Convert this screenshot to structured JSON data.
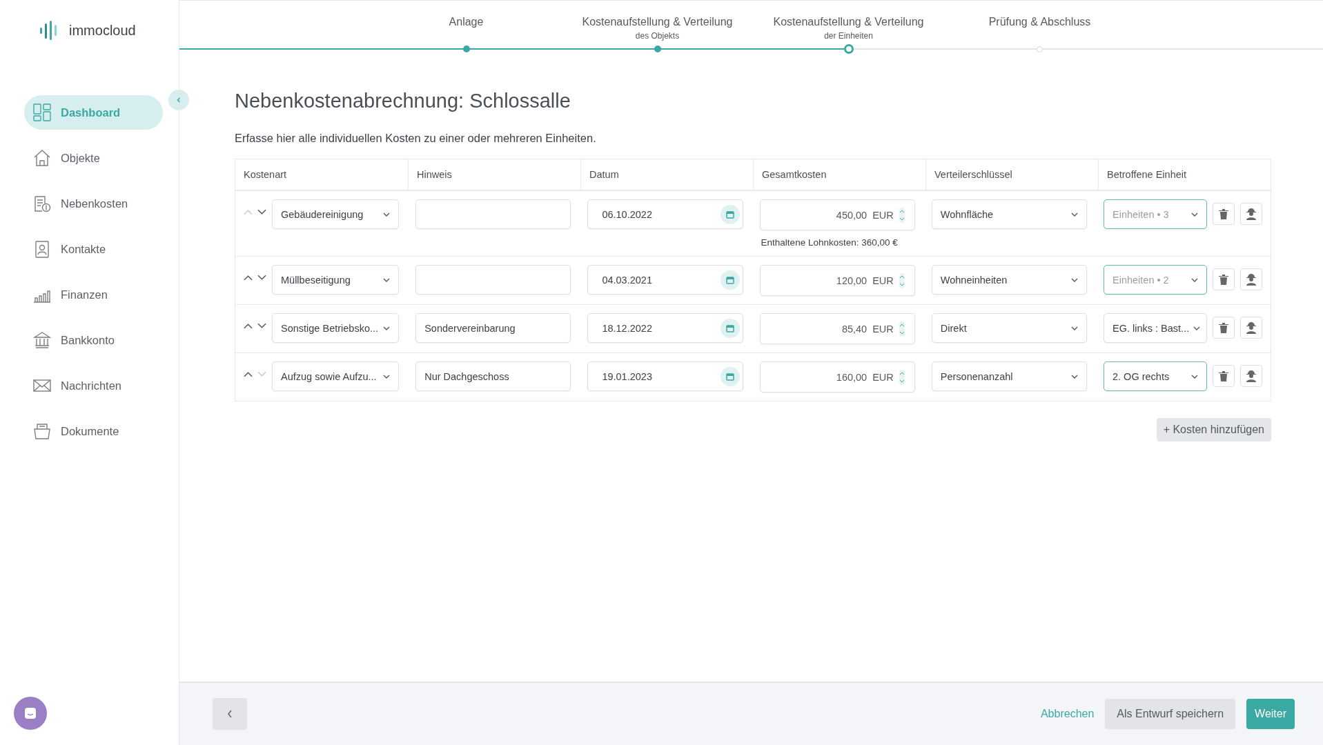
{
  "brand": {
    "name": "immocloud"
  },
  "sidebar": {
    "items": [
      {
        "label": "Dashboard",
        "selected": true
      },
      {
        "label": "Objekte",
        "selected": false
      },
      {
        "label": "Nebenkosten",
        "selected": false
      },
      {
        "label": "Kontakte",
        "selected": false
      },
      {
        "label": "Finanzen",
        "selected": false
      },
      {
        "label": "Bankkonto",
        "selected": false
      },
      {
        "label": "Nachrichten",
        "selected": false
      },
      {
        "label": "Dokumente",
        "selected": false
      }
    ]
  },
  "stepper": {
    "steps": [
      {
        "title": "Anlage",
        "completed": true,
        "selected": false
      },
      {
        "title": "Kostenaufstellung & Verteilung",
        "subtitle": "des Objekts",
        "completed": true,
        "selected": false
      },
      {
        "title": "Kostenaufstellung & Verteilung",
        "subtitle": "der Einheiten",
        "completed": false,
        "selected": true
      },
      {
        "title": "Prüfung & Abschluss",
        "completed": false,
        "selected": false
      }
    ]
  },
  "page": {
    "title": "Nebenkostenabrechnung: Schlossalle",
    "intro": "Erfasse hier alle individuellen Kosten zu einer oder mehreren Einheiten."
  },
  "table": {
    "columns": [
      "Kostenart",
      "Hinweis",
      "Datum",
      "Gesamtkosten",
      "Verteilerschlüssel",
      "Betroffene Einheit"
    ],
    "rows": [
      {
        "up_disabled": true,
        "down_disabled": false,
        "cost_type": "Gebäudereinigung",
        "date": "06.10.2022",
        "amount": "450,00",
        "currency": "EUR",
        "note": "Enthaltene Lohnkosten: 360,00 €",
        "key": "Wohnfläche",
        "unit": {
          "placeholder": "Einheiten • 3",
          "highlighted": true
        }
      },
      {
        "up_disabled": false,
        "down_disabled": false,
        "cost_type": "Müllbeseitigung",
        "date": "04.03.2021",
        "amount": "120,00",
        "currency": "EUR",
        "key": "Wohneinheiten",
        "unit": {
          "placeholder": "Einheiten • 2",
          "highlighted": true
        }
      },
      {
        "up_disabled": false,
        "down_disabled": false,
        "cost_type": "Sonstige Betriebsko...",
        "hint": "Sondervereinbarung",
        "date": "18.12.2022",
        "amount": "85,40",
        "currency": "EUR",
        "key": "Direkt",
        "unit": {
          "value": "EG. links : Bast...",
          "highlighted": false
        }
      },
      {
        "up_disabled": false,
        "down_disabled": true,
        "cost_type": "Aufzug sowie Aufzu...",
        "hint": "Nur Dachgeschoss",
        "date": "19.01.2023",
        "amount": "160,00",
        "currency": "EUR",
        "key": "Personenanzahl",
        "unit": {
          "value": "2. OG rechts",
          "highlighted": true
        }
      }
    ]
  },
  "add_button": "+ Kosten hinzufügen",
  "footer": {
    "cancel": "Abbrechen",
    "save_draft": "Als Entwurf speichern",
    "next": "Weiter"
  }
}
